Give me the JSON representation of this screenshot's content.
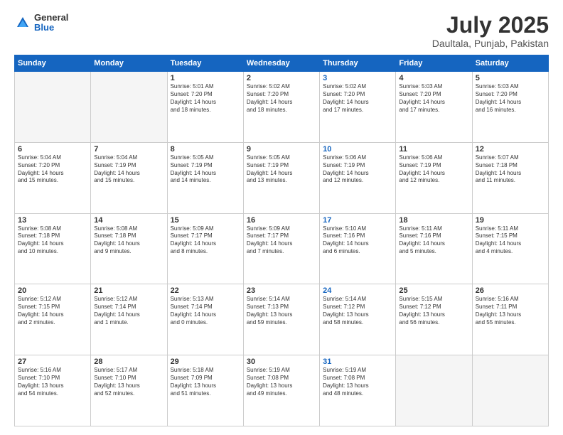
{
  "logo": {
    "general": "General",
    "blue": "Blue"
  },
  "header": {
    "month": "July 2025",
    "location": "Daultala, Punjab, Pakistan"
  },
  "weekdays": [
    "Sunday",
    "Monday",
    "Tuesday",
    "Wednesday",
    "Thursday",
    "Friday",
    "Saturday"
  ],
  "weeks": [
    [
      {
        "day": "",
        "text": "",
        "empty": true
      },
      {
        "day": "",
        "text": "",
        "empty": true
      },
      {
        "day": "1",
        "text": "Sunrise: 5:01 AM\nSunset: 7:20 PM\nDaylight: 14 hours\nand 18 minutes."
      },
      {
        "day": "2",
        "text": "Sunrise: 5:02 AM\nSunset: 7:20 PM\nDaylight: 14 hours\nand 18 minutes."
      },
      {
        "day": "3",
        "text": "Sunrise: 5:02 AM\nSunset: 7:20 PM\nDaylight: 14 hours\nand 17 minutes.",
        "thursday": true
      },
      {
        "day": "4",
        "text": "Sunrise: 5:03 AM\nSunset: 7:20 PM\nDaylight: 14 hours\nand 17 minutes."
      },
      {
        "day": "5",
        "text": "Sunrise: 5:03 AM\nSunset: 7:20 PM\nDaylight: 14 hours\nand 16 minutes."
      }
    ],
    [
      {
        "day": "6",
        "text": "Sunrise: 5:04 AM\nSunset: 7:20 PM\nDaylight: 14 hours\nand 15 minutes."
      },
      {
        "day": "7",
        "text": "Sunrise: 5:04 AM\nSunset: 7:19 PM\nDaylight: 14 hours\nand 15 minutes."
      },
      {
        "day": "8",
        "text": "Sunrise: 5:05 AM\nSunset: 7:19 PM\nDaylight: 14 hours\nand 14 minutes."
      },
      {
        "day": "9",
        "text": "Sunrise: 5:05 AM\nSunset: 7:19 PM\nDaylight: 14 hours\nand 13 minutes."
      },
      {
        "day": "10",
        "text": "Sunrise: 5:06 AM\nSunset: 7:19 PM\nDaylight: 14 hours\nand 12 minutes.",
        "thursday": true
      },
      {
        "day": "11",
        "text": "Sunrise: 5:06 AM\nSunset: 7:19 PM\nDaylight: 14 hours\nand 12 minutes."
      },
      {
        "day": "12",
        "text": "Sunrise: 5:07 AM\nSunset: 7:18 PM\nDaylight: 14 hours\nand 11 minutes."
      }
    ],
    [
      {
        "day": "13",
        "text": "Sunrise: 5:08 AM\nSunset: 7:18 PM\nDaylight: 14 hours\nand 10 minutes."
      },
      {
        "day": "14",
        "text": "Sunrise: 5:08 AM\nSunset: 7:18 PM\nDaylight: 14 hours\nand 9 minutes."
      },
      {
        "day": "15",
        "text": "Sunrise: 5:09 AM\nSunset: 7:17 PM\nDaylight: 14 hours\nand 8 minutes."
      },
      {
        "day": "16",
        "text": "Sunrise: 5:09 AM\nSunset: 7:17 PM\nDaylight: 14 hours\nand 7 minutes."
      },
      {
        "day": "17",
        "text": "Sunrise: 5:10 AM\nSunset: 7:16 PM\nDaylight: 14 hours\nand 6 minutes.",
        "thursday": true
      },
      {
        "day": "18",
        "text": "Sunrise: 5:11 AM\nSunset: 7:16 PM\nDaylight: 14 hours\nand 5 minutes."
      },
      {
        "day": "19",
        "text": "Sunrise: 5:11 AM\nSunset: 7:15 PM\nDaylight: 14 hours\nand 4 minutes."
      }
    ],
    [
      {
        "day": "20",
        "text": "Sunrise: 5:12 AM\nSunset: 7:15 PM\nDaylight: 14 hours\nand 2 minutes."
      },
      {
        "day": "21",
        "text": "Sunrise: 5:12 AM\nSunset: 7:14 PM\nDaylight: 14 hours\nand 1 minute."
      },
      {
        "day": "22",
        "text": "Sunrise: 5:13 AM\nSunset: 7:14 PM\nDaylight: 14 hours\nand 0 minutes."
      },
      {
        "day": "23",
        "text": "Sunrise: 5:14 AM\nSunset: 7:13 PM\nDaylight: 13 hours\nand 59 minutes."
      },
      {
        "day": "24",
        "text": "Sunrise: 5:14 AM\nSunset: 7:12 PM\nDaylight: 13 hours\nand 58 minutes.",
        "thursday": true
      },
      {
        "day": "25",
        "text": "Sunrise: 5:15 AM\nSunset: 7:12 PM\nDaylight: 13 hours\nand 56 minutes."
      },
      {
        "day": "26",
        "text": "Sunrise: 5:16 AM\nSunset: 7:11 PM\nDaylight: 13 hours\nand 55 minutes."
      }
    ],
    [
      {
        "day": "27",
        "text": "Sunrise: 5:16 AM\nSunset: 7:10 PM\nDaylight: 13 hours\nand 54 minutes."
      },
      {
        "day": "28",
        "text": "Sunrise: 5:17 AM\nSunset: 7:10 PM\nDaylight: 13 hours\nand 52 minutes."
      },
      {
        "day": "29",
        "text": "Sunrise: 5:18 AM\nSunset: 7:09 PM\nDaylight: 13 hours\nand 51 minutes."
      },
      {
        "day": "30",
        "text": "Sunrise: 5:19 AM\nSunset: 7:08 PM\nDaylight: 13 hours\nand 49 minutes."
      },
      {
        "day": "31",
        "text": "Sunrise: 5:19 AM\nSunset: 7:08 PM\nDaylight: 13 hours\nand 48 minutes.",
        "thursday": true
      },
      {
        "day": "",
        "text": "",
        "empty": true
      },
      {
        "day": "",
        "text": "",
        "empty": true
      }
    ]
  ]
}
